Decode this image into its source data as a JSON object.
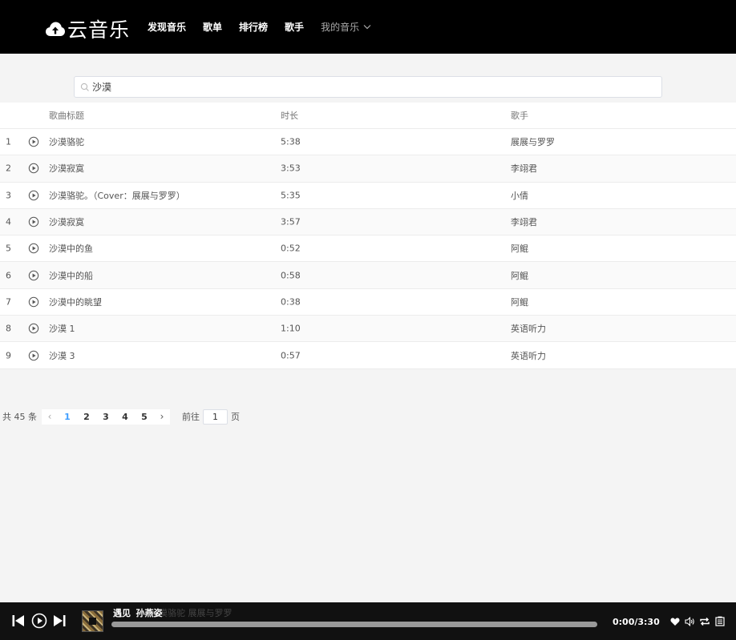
{
  "app": {
    "logo_text": "云音乐"
  },
  "nav": {
    "items": [
      "发现音乐",
      "歌单",
      "排行榜",
      "歌手"
    ],
    "my_music": "我的音乐"
  },
  "search": {
    "value": "沙漠"
  },
  "table": {
    "headers": {
      "title": "歌曲标题",
      "duration": "时长",
      "artist": "歌手"
    },
    "rows": [
      {
        "index": "1",
        "title": "沙漠骆驼",
        "duration": "5:38",
        "artist": "展展与罗罗"
      },
      {
        "index": "2",
        "title": "沙漠寂寞",
        "duration": "3:53",
        "artist": "李翊君"
      },
      {
        "index": "3",
        "title": "沙漠骆驼。（Cover：展展与罗罗）",
        "duration": "5:35",
        "artist": "小倩"
      },
      {
        "index": "4",
        "title": "沙漠寂寞",
        "duration": "3:57",
        "artist": "李翊君"
      },
      {
        "index": "5",
        "title": "沙漠中的鱼",
        "duration": "0:52",
        "artist": "阿鲲"
      },
      {
        "index": "6",
        "title": "沙漠中的船",
        "duration": "0:58",
        "artist": "阿鲲"
      },
      {
        "index": "7",
        "title": "沙漠中的眺望",
        "duration": "0:38",
        "artist": "阿鲲"
      },
      {
        "index": "8",
        "title": "沙漠 1",
        "duration": "1:10",
        "artist": "英语听力"
      },
      {
        "index": "9",
        "title": "沙漠 3",
        "duration": "0:57",
        "artist": "英语听力"
      }
    ]
  },
  "pagination": {
    "total": "共 45 条",
    "pages": [
      "1",
      "2",
      "3",
      "4",
      "5"
    ],
    "current": "1",
    "jump_prefix": "前往",
    "jump_value": "1",
    "jump_suffix": "页"
  },
  "player": {
    "title": "遇见",
    "artist": "孙燕姿",
    "ghost_text": "沙漠骆驼 展展与罗罗",
    "time": "0:00/3:30",
    "progress": 0
  },
  "colors": {
    "accent": "#409eff",
    "header_bg": "#000000",
    "player_bg": "#111111"
  }
}
